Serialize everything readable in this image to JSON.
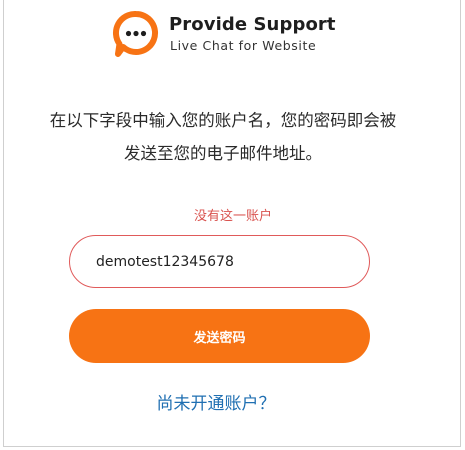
{
  "brand": {
    "name": "Provide Support",
    "tagline": "Live Chat for Website",
    "logo_icon": "chat-bubble-icon",
    "accent_color": "#f77314"
  },
  "form": {
    "instructions_line1": "在以下字段中输入您的账户名，您的密码即会被",
    "instructions_line2": "发送至您的电子邮件地址。",
    "error_message": "没有这一账户",
    "account_input_value": "demotest12345678",
    "submit_label": "发送密码",
    "no_account_link": "尚未开通账户？"
  }
}
